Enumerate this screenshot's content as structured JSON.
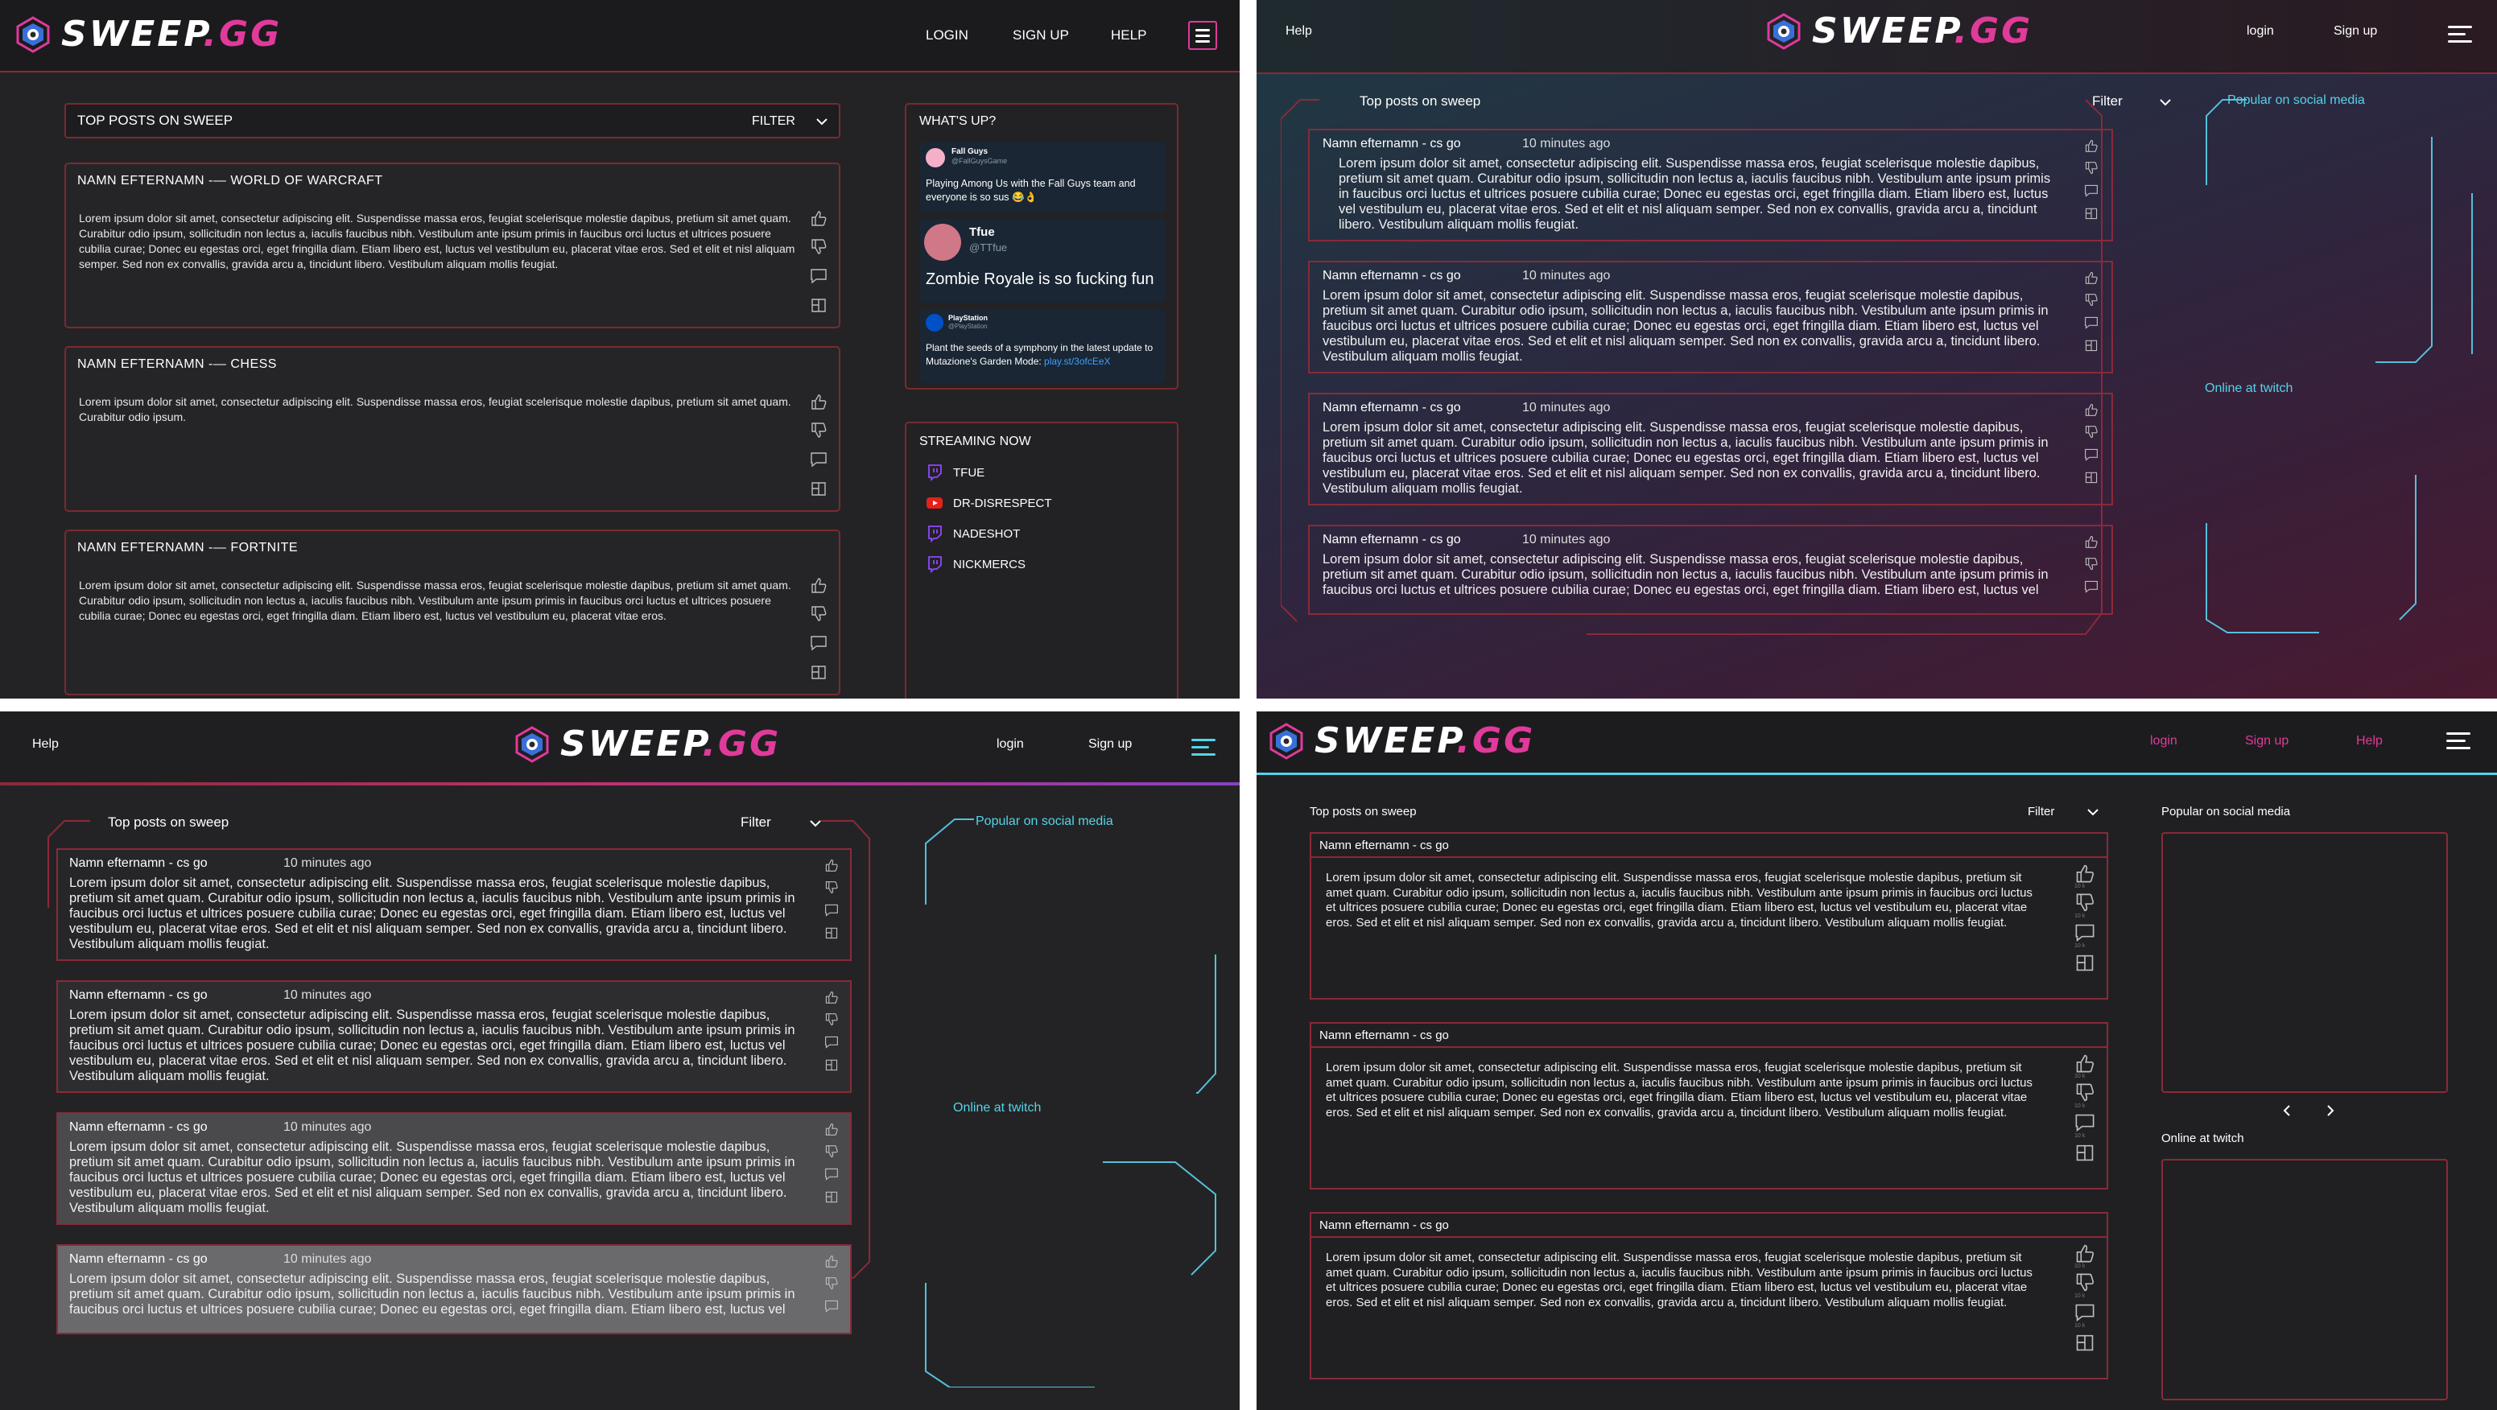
{
  "brand": {
    "name_main": "SWEEP",
    "name_suffix": ".GG"
  },
  "lorem_long": "Lorem ipsum dolor sit amet, consectetur adipiscing elit. Suspendisse massa eros, feugiat scelerisque molestie dapibus, pretium sit amet quam. Curabitur odio ipsum, sollicitudin non lectus a, iaculis faucibus nibh. Vestibulum ante ipsum primis in faucibus orci luctus et ultrices posuere cubilia curae; Donec eu egestas orci, eget fringilla diam. Etiam libero est, luctus vel vestibulum eu, placerat vitae eros. Sed et elit et nisl aliquam semper. Sed non ex convallis, gravida arcu a, tincidunt libero. Vestibulum aliquam mollis feugiat.",
  "panel1": {
    "nav": {
      "login": "LOGIN",
      "signup": "SIGN UP",
      "help": "HELP"
    },
    "feed_title": "TOP POSTS ON SWEEP",
    "filter": "FILTER",
    "posts": [
      {
        "title": "NAMN EFTERNAMN -— WORLD OF WARCRAFT",
        "body": "Lorem ipsum dolor sit amet, consectetur adipiscing elit. Suspendisse massa eros, feugiat scelerisque molestie dapibus, pretium sit amet quam. Curabitur odio ipsum, sollicitudin non lectus a, iaculis faucibus nibh. Vestibulum ante ipsum primis in faucibus orci luctus et ultrices posuere cubilia curae; Donec eu egestas orci, eget fringilla diam. Etiam libero est, luctus vel vestibulum eu, placerat vitae eros. Sed et elit et nisl aliquam semper. Sed non ex convallis, gravida arcu a, tincidunt libero. Vestibulum aliquam mollis feugiat."
      },
      {
        "title": "NAMN EFTERNAMN -— CHESS",
        "body": "Lorem ipsum dolor sit amet, consectetur adipiscing elit. Suspendisse massa eros, feugiat scelerisque molestie dapibus, pretium sit amet quam. Curabitur odio ipsum."
      },
      {
        "title": "NAMN EFTERNAMN -— FORTNITE",
        "body": "Lorem ipsum dolor sit amet, consectetur adipiscing elit. Suspendisse massa eros, feugiat scelerisque molestie dapibus, pretium sit amet quam. Curabitur odio ipsum, sollicitudin non lectus a, iaculis faucibus nibh. Vestibulum ante ipsum primis in faucibus orci luctus et ultrices posuere cubilia curae; Donec eu egestas orci, eget fringilla diam. Etiam libero est, luctus vel vestibulum eu, placerat vitae eros."
      }
    ],
    "whats_up": {
      "title": "WHAT'S UP?",
      "tweets": [
        {
          "name": "Fall Guys",
          "handle": "@FallGuysGame",
          "text": "Playing Among Us with the Fall Guys team and everyone is so sus 😂👌"
        },
        {
          "name": "Tfue",
          "handle": "@TTfue",
          "text": "Zombie Royale is so fucking fun"
        },
        {
          "name": "PlayStation",
          "handle": "@PlayStation",
          "text": "Plant the seeds of a symphony in the latest update to Mutazione's Garden Mode:",
          "link": "play.st/3ofcEeX"
        }
      ]
    },
    "streaming": {
      "title": "STREAMING NOW",
      "items": [
        {
          "name": "TFUE",
          "platform": "twitch"
        },
        {
          "name": "DR-DISRESPECT",
          "platform": "youtube"
        },
        {
          "name": "NADESHOT",
          "platform": "twitch"
        },
        {
          "name": "NICKMERCS",
          "platform": "twitch"
        }
      ]
    }
  },
  "panel2": {
    "nav": {
      "help": "Help",
      "login": "login",
      "signup": "Sign up"
    },
    "feed_title": "Top posts on sweep",
    "filter": "Filter",
    "popular": "Popular on social media",
    "twitch": "Online at twitch",
    "post_name": "Namn efternamn - cs go",
    "post_time": "10 minutes ago"
  },
  "panel3": {
    "nav": {
      "help": "Help",
      "login": "login",
      "signup": "Sign up"
    },
    "feed_title": "Top posts on sweep",
    "filter": "Filter",
    "popular": "Popular on social media",
    "twitch": "Online at twitch",
    "post_name": "Namn efternamn - cs go",
    "post_time": "10 minutes ago"
  },
  "panel4": {
    "nav": {
      "login": "login",
      "signup": "Sign up",
      "help": "Help"
    },
    "feed_title": "Top posts on sweep",
    "filter": "Filter",
    "popular": "Popular on social media",
    "twitch": "Online at twitch",
    "post_name": "Namn efternamn - cs go",
    "count_label": "10 k"
  },
  "colors": {
    "accent_red": "#8a2a38",
    "accent_pink": "#e03a9a",
    "accent_cyan": "#55d4e8"
  }
}
